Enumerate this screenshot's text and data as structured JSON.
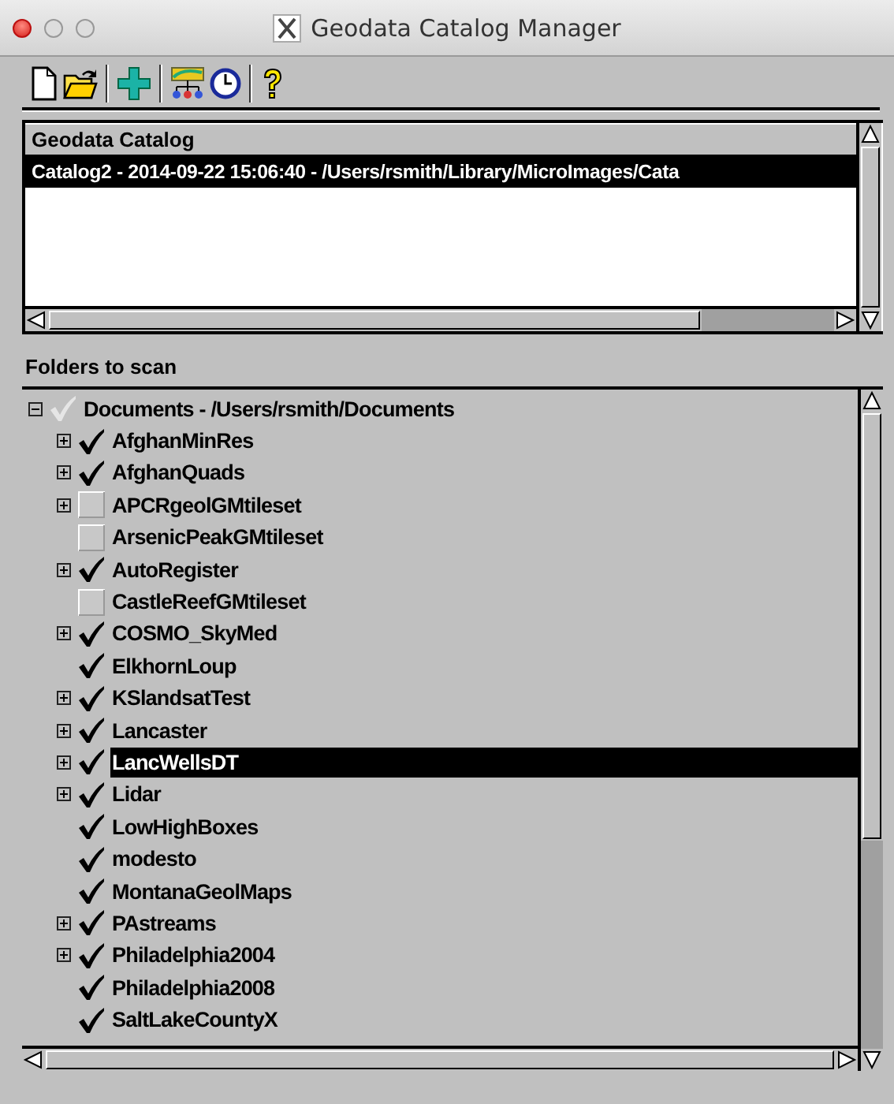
{
  "window": {
    "title": "Geodata Catalog Manager"
  },
  "catalog": {
    "columns": [
      "Geodata Catalog"
    ],
    "rows": [
      {
        "text": "Catalog2 - 2014-09-22 15:06:40 - /Users/rsmith/Library/MicroImages/Cata",
        "selected": true
      }
    ]
  },
  "folders": {
    "label": "Folders to scan",
    "tree": [
      {
        "label": "Documents - /Users/rsmith/Documents",
        "kind": "branch",
        "expanded": true,
        "checked": true,
        "disabled": true,
        "selected": false,
        "children": [
          {
            "label": "AfghanMinRes",
            "kind": "branch",
            "expanded": false,
            "checked": true,
            "disabled": false,
            "selected": false
          },
          {
            "label": "AfghanQuads",
            "kind": "branch",
            "expanded": false,
            "checked": true,
            "disabled": false,
            "selected": false
          },
          {
            "label": "APCRgeolGMtileset",
            "kind": "branch",
            "expanded": false,
            "checked": false,
            "disabled": false,
            "selected": false
          },
          {
            "label": "ArsenicPeakGMtileset",
            "kind": "leaf",
            "checked": false,
            "disabled": false,
            "selected": false
          },
          {
            "label": "AutoRegister",
            "kind": "branch",
            "expanded": false,
            "checked": true,
            "disabled": false,
            "selected": false
          },
          {
            "label": "CastleReefGMtileset",
            "kind": "leaf",
            "checked": false,
            "disabled": false,
            "selected": false
          },
          {
            "label": "COSMO_SkyMed",
            "kind": "branch",
            "expanded": false,
            "checked": true,
            "disabled": false,
            "selected": false
          },
          {
            "label": "ElkhornLoup",
            "kind": "leaf",
            "checked": true,
            "disabled": false,
            "selected": false
          },
          {
            "label": "KSlandsatTest",
            "kind": "branch",
            "expanded": false,
            "checked": true,
            "disabled": false,
            "selected": false
          },
          {
            "label": "Lancaster",
            "kind": "branch",
            "expanded": false,
            "checked": true,
            "disabled": false,
            "selected": false
          },
          {
            "label": "LancWellsDT",
            "kind": "branch",
            "expanded": false,
            "checked": true,
            "disabled": false,
            "selected": true
          },
          {
            "label": "Lidar",
            "kind": "branch",
            "expanded": false,
            "checked": true,
            "disabled": false,
            "selected": false
          },
          {
            "label": "LowHighBoxes",
            "kind": "leaf",
            "checked": true,
            "disabled": false,
            "selected": false
          },
          {
            "label": "modesto",
            "kind": "leaf",
            "checked": true,
            "disabled": false,
            "selected": false
          },
          {
            "label": "MontanaGeolMaps",
            "kind": "leaf",
            "checked": true,
            "disabled": false,
            "selected": false
          },
          {
            "label": "PAstreams",
            "kind": "branch",
            "expanded": false,
            "checked": true,
            "disabled": false,
            "selected": false
          },
          {
            "label": "Philadelphia2004",
            "kind": "branch",
            "expanded": false,
            "checked": true,
            "disabled": false,
            "selected": false
          },
          {
            "label": "Philadelphia2008",
            "kind": "leaf",
            "checked": true,
            "disabled": false,
            "selected": false
          },
          {
            "label": "SaltLakeCountyX",
            "kind": "leaf",
            "checked": true,
            "disabled": false,
            "selected": false
          }
        ]
      }
    ]
  }
}
